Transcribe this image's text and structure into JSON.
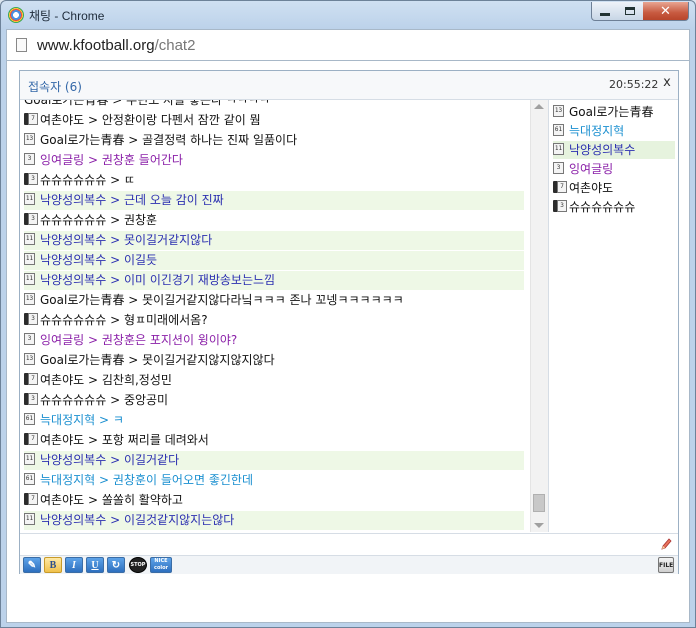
{
  "window": {
    "title": "채팅 - Chrome"
  },
  "address_bar": {
    "host": "www.kfootball.org",
    "path": "/chat2"
  },
  "chat": {
    "participants_label": "접속자 (6)",
    "time": "20:55:22",
    "close_label": "x",
    "messages": [
      {
        "badge": "",
        "user": "Goal로가는青春",
        "sep": " > ",
        "text": "우린도 자을 좋든다 ㅋㅋㅋㅋ",
        "color": "#111111",
        "hl": false
      },
      {
        "badge": "phone",
        "level": "7",
        "user": "여촌야도",
        "sep": " > ",
        "text": "안정환이랑 다펜서 잠깐 같이 뭠",
        "color": "#111111",
        "hl": false
      },
      {
        "badge": "solo",
        "level": "13",
        "user": "Goal로가는青春",
        "sep": " > ",
        "text": "골결정력 하나는 진짜 일품이다",
        "color": "#111111",
        "hl": false
      },
      {
        "badge": "solo",
        "level": "3",
        "user": "잉여글링",
        "sep": " > ",
        "text": "권창훈 들어간다",
        "color": "#8a1fa8",
        "hl": false
      },
      {
        "badge": "phone",
        "level": "3",
        "user": "슈슈슈슈슈슈",
        "sep": " > ",
        "text": "ㄸ",
        "color": "#111111",
        "hl": false
      },
      {
        "badge": "solo",
        "level": "11",
        "user": "낙양성의복수",
        "sep": " > ",
        "text": "근데 오늘 감이 진짜",
        "color": "#2b2fb0",
        "hl": true
      },
      {
        "badge": "phone",
        "level": "3",
        "user": "슈슈슈슈슈슈",
        "sep": " > ",
        "text": "권창훈",
        "color": "#111111",
        "hl": false
      },
      {
        "badge": "solo",
        "level": "11",
        "user": "낙양성의복수",
        "sep": " > ",
        "text": "못이길거같지않다",
        "color": "#2b2fb0",
        "hl": true
      },
      {
        "badge": "solo",
        "level": "11",
        "user": "낙양성의복수",
        "sep": " > ",
        "text": "이길듯",
        "color": "#2b2fb0",
        "hl": true
      },
      {
        "badge": "solo",
        "level": "11",
        "user": "낙양성의복수",
        "sep": " > ",
        "text": "이미 이긴경기 재방송보는느낌",
        "color": "#2b2fb0",
        "hl": true
      },
      {
        "badge": "solo",
        "level": "13",
        "user": "Goal로가는青春",
        "sep": " > ",
        "text": "못이길거같지않다라닠ㅋㅋㅋ 존나 꼬넹ㅋㅋㅋㅋㅋㅋ",
        "color": "#111111",
        "hl": false
      },
      {
        "badge": "phone",
        "level": "3",
        "user": "슈슈슈슈슈슈",
        "sep": " > ",
        "text": "형ㅍ미래에서옴?",
        "color": "#111111",
        "hl": false
      },
      {
        "badge": "solo",
        "level": "3",
        "user": "잉여글링",
        "sep": " > ",
        "text": "권창훈은 포지션이 윙이야?",
        "color": "#8a1fa8",
        "hl": false
      },
      {
        "badge": "solo",
        "level": "13",
        "user": "Goal로가는青春",
        "sep": " > ",
        "text": "못이길거같지않지않지않다",
        "color": "#111111",
        "hl": false
      },
      {
        "badge": "phone",
        "level": "7",
        "user": "여촌야도",
        "sep": " > ",
        "text": "김찬희,정성민",
        "color": "#111111",
        "hl": false
      },
      {
        "badge": "phone",
        "level": "3",
        "user": "슈슈슈슈슈슈",
        "sep": " > ",
        "text": "중앙공미",
        "color": "#111111",
        "hl": false
      },
      {
        "badge": "solo",
        "level": "61",
        "user": "늑대정지혁",
        "sep": " > ",
        "text": "ㅋ",
        "color": "#1a8fd0",
        "hl": false
      },
      {
        "badge": "phone",
        "level": "7",
        "user": "여촌야도",
        "sep": " > ",
        "text": "포항 쩌리를 데려와서",
        "color": "#111111",
        "hl": false
      },
      {
        "badge": "solo",
        "level": "11",
        "user": "낙양성의복수",
        "sep": " > ",
        "text": "이길거같다",
        "color": "#2b2fb0",
        "hl": true
      },
      {
        "badge": "solo",
        "level": "61",
        "user": "늑대정지혁",
        "sep": " > ",
        "text": "권창훈이 들어오면 좋긴한데",
        "color": "#1a8fd0",
        "hl": false
      },
      {
        "badge": "phone",
        "level": "7",
        "user": "여촌야도",
        "sep": " > ",
        "text": "쏠쏠히 활약하고",
        "color": "#111111",
        "hl": false
      },
      {
        "badge": "solo",
        "level": "11",
        "user": "낙양성의복수",
        "sep": " > ",
        "text": "이길것같지않지는않다",
        "color": "#2b2fb0",
        "hl": true
      }
    ],
    "users": [
      {
        "badge": "solo",
        "level": "13",
        "name": "Goal로가는青春",
        "color": "#111111",
        "sel": false
      },
      {
        "badge": "solo",
        "level": "61",
        "name": "늑대정지혁",
        "color": "#1a8fd0",
        "sel": false
      },
      {
        "badge": "solo",
        "level": "11",
        "name": "낙양성의복수",
        "color": "#2b2fb0",
        "sel": true
      },
      {
        "badge": "solo",
        "level": "3",
        "name": "잉여글링",
        "color": "#8a1fa8",
        "sel": false
      },
      {
        "badge": "phone",
        "level": "7",
        "name": "여촌야도",
        "color": "#111111",
        "sel": false
      },
      {
        "badge": "phone",
        "level": "3",
        "name": "슈슈슈슈슈슈",
        "color": "#111111",
        "sel": false
      }
    ],
    "toolbar": {
      "bold_label": "B",
      "italic_label": "I",
      "underline_label": "U",
      "stop_label": "STOP",
      "color_label": "NICE color",
      "file_label": "FILE"
    }
  }
}
